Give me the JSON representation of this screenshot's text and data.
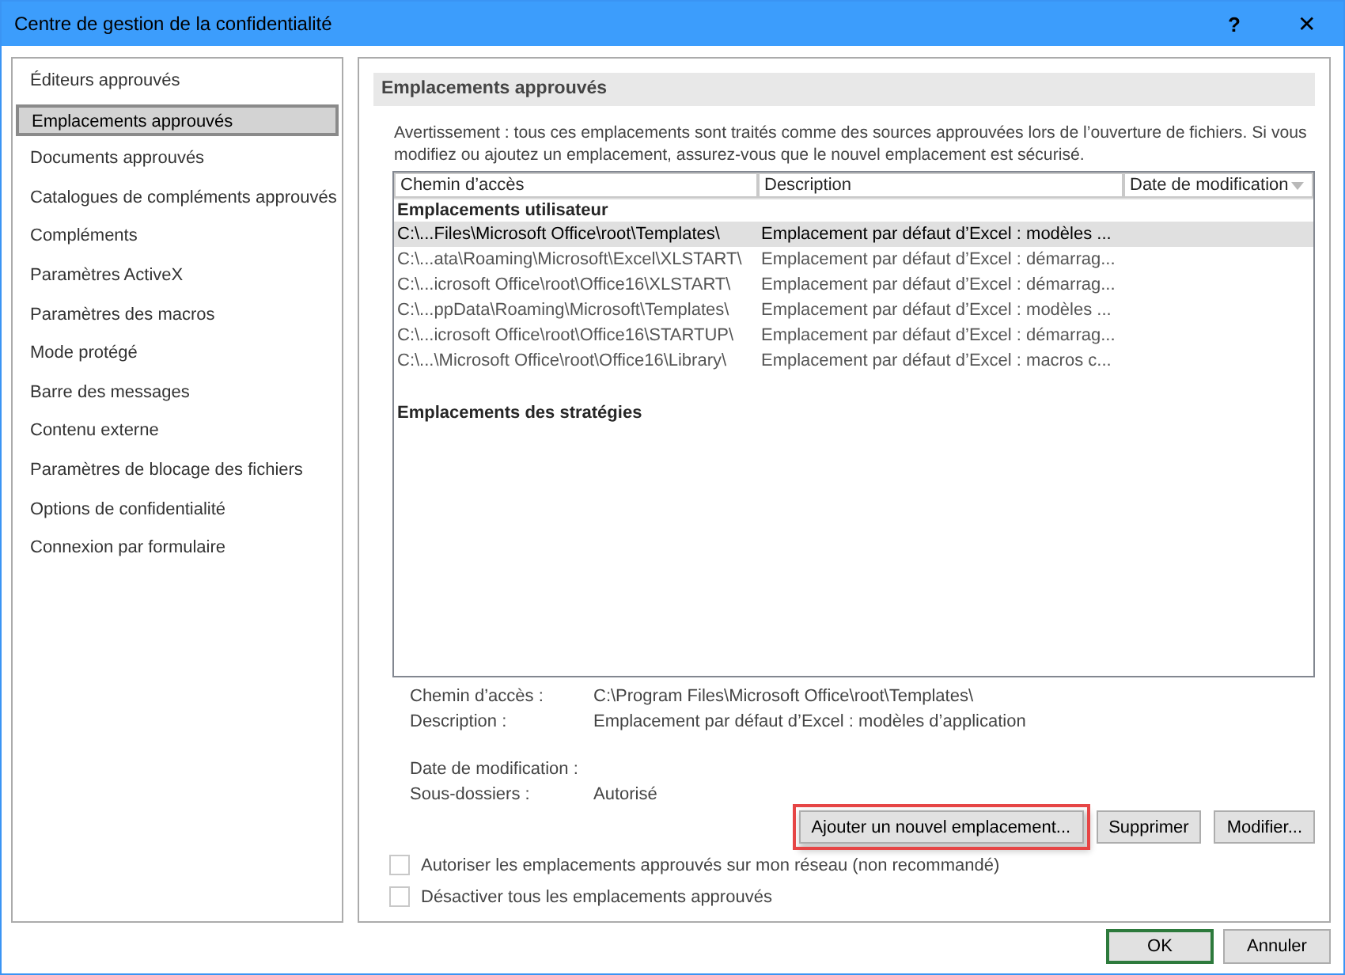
{
  "window": {
    "title": "Centre de gestion de la confidentialité",
    "help": "?",
    "close": "✕"
  },
  "sidebar": {
    "items": [
      {
        "label": "Éditeurs approuvés",
        "selected": false
      },
      {
        "label": "Emplacements approuvés",
        "selected": true
      },
      {
        "label": "Documents approuvés",
        "selected": false
      },
      {
        "label": "Catalogues de compléments approuvés",
        "selected": false
      },
      {
        "label": "Compléments",
        "selected": false
      },
      {
        "label": "Paramètres ActiveX",
        "selected": false
      },
      {
        "label": "Paramètres des macros",
        "selected": false
      },
      {
        "label": "Mode protégé",
        "selected": false
      },
      {
        "label": "Barre des messages",
        "selected": false
      },
      {
        "label": "Contenu externe",
        "selected": false
      },
      {
        "label": "Paramètres de blocage des fichiers",
        "selected": false
      },
      {
        "label": "Options de confidentialité",
        "selected": false
      },
      {
        "label": "Connexion par formulaire",
        "selected": false
      }
    ]
  },
  "section": {
    "title": "Emplacements approuvés",
    "warning": "Avertissement : tous ces emplacements sont traités comme des sources approuvées lors de l’ouverture de fichiers. Si vous modifiez ou ajoutez un emplacement, assurez-vous que le nouvel emplacement est sécurisé."
  },
  "table": {
    "columns": [
      "Chemin d’accès",
      "Description",
      "Date de modification"
    ],
    "groups": [
      {
        "title": "Emplacements utilisateur",
        "rows": [
          {
            "path": "C:\\...Files\\Microsoft Office\\root\\Templates\\",
            "description": "Emplacement par défaut d’Excel : modèles ...",
            "selected": true
          },
          {
            "path": "C:\\...ata\\Roaming\\Microsoft\\Excel\\XLSTART\\",
            "description": "Emplacement par défaut d’Excel : démarrag...",
            "selected": false
          },
          {
            "path": "C:\\...icrosoft Office\\root\\Office16\\XLSTART\\",
            "description": "Emplacement par défaut d’Excel : démarrag...",
            "selected": false
          },
          {
            "path": "C:\\...ppData\\Roaming\\Microsoft\\Templates\\",
            "description": "Emplacement par défaut d’Excel : modèles ...",
            "selected": false
          },
          {
            "path": "C:\\...icrosoft Office\\root\\Office16\\STARTUP\\",
            "description": "Emplacement par défaut d’Excel : démarrag...",
            "selected": false
          },
          {
            "path": "C:\\...\\Microsoft Office\\root\\Office16\\Library\\",
            "description": "Emplacement par défaut d’Excel : macros c...",
            "selected": false
          }
        ]
      },
      {
        "title": "Emplacements des stratégies"
      }
    ]
  },
  "details": [
    {
      "label": "Chemin d’accès :",
      "value": "C:\\Program Files\\Microsoft Office\\root\\Templates\\"
    },
    {
      "label": "Description :",
      "value": "Emplacement par défaut d’Excel : modèles d’application"
    },
    {
      "label": "Date de modification :"
    },
    {
      "label": "Sous-dossiers :",
      "value": "Autorisé"
    }
  ],
  "actions": [
    {
      "label": "Ajouter un nouvel emplacement...",
      "highlighted": true
    },
    {
      "label": "Supprimer",
      "highlighted": false
    },
    {
      "label": "Modifier...",
      "highlighted": false
    }
  ],
  "options": [
    {
      "label": "Autoriser les emplacements approuvés sur mon réseau (non recommandé)",
      "checked": false
    },
    {
      "label": "Désactiver tous les emplacements approuvés",
      "checked": false
    }
  ],
  "footer": [
    {
      "label": "OK",
      "default": true
    },
    {
      "label": "Annuler",
      "default": false
    }
  ]
}
